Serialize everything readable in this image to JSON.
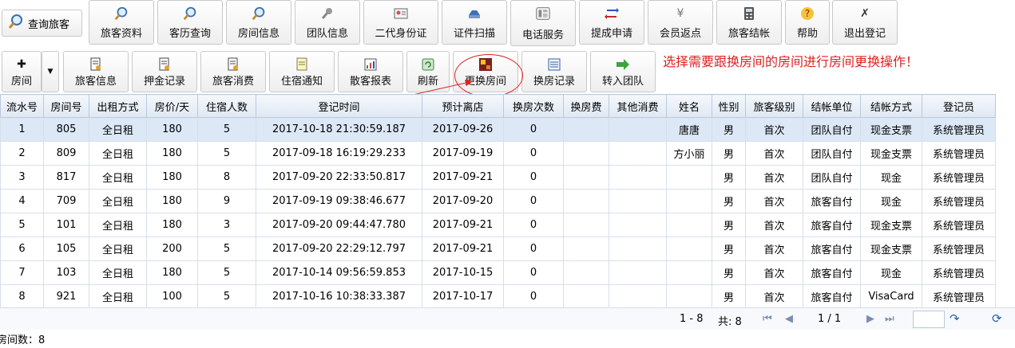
{
  "toolbar1": {
    "search_label": "查询旅客",
    "buttons": [
      {
        "label": "旅客资料",
        "icon": "magnifier-icon"
      },
      {
        "label": "客历查询",
        "icon": "magnifier-icon"
      },
      {
        "label": "房间信息",
        "icon": "magnifier-icon"
      },
      {
        "label": "团队信息",
        "icon": "wrench-icon"
      },
      {
        "label": "二代身份证",
        "icon": "id-card-icon"
      },
      {
        "label": "证件扫描",
        "icon": "scanner-icon"
      },
      {
        "label": "电话服务",
        "icon": "telephone-icon"
      },
      {
        "label": "提成申请",
        "icon": "arrows-icon"
      },
      {
        "label": "会员返点",
        "icon": "yen-icon"
      },
      {
        "label": "旅客结帐",
        "icon": "calculator-icon"
      },
      {
        "label": "帮助",
        "icon": "help-icon"
      },
      {
        "label": "退出登记",
        "icon": "close-icon"
      }
    ]
  },
  "toolbar2": {
    "room_label": "房间",
    "buttons": [
      {
        "label": "旅客信息",
        "icon": "document-icon"
      },
      {
        "label": "押金记录",
        "icon": "document-icon"
      },
      {
        "label": "旅客消费",
        "icon": "document-icon"
      },
      {
        "label": "住宿通知",
        "icon": "note-icon"
      },
      {
        "label": "散客报表",
        "icon": "report-icon"
      },
      {
        "label": "刷新",
        "icon": "refresh-icon"
      },
      {
        "label": "更换房间",
        "icon": "swap-room-icon"
      },
      {
        "label": "换房记录",
        "icon": "list-icon"
      },
      {
        "label": "转入团队",
        "icon": "green-arrow-icon"
      }
    ]
  },
  "annotation": "选择需要跟换房间的房间进行房间更换操作！",
  "table": {
    "headers": [
      "流水号",
      "房间号",
      "出租方式",
      "房价/天",
      "住宿人数",
      "登记时间",
      "预计离店",
      "换房次数",
      "换房费",
      "其他消费",
      "姓名",
      "性别",
      "旅客级别",
      "结帐单位",
      "结帐方式",
      "登记员"
    ],
    "rows": [
      [
        "1",
        "805",
        "全日租",
        "180",
        "5",
        "2017-10-18 21:30:59.187",
        "2017-09-26",
        "0",
        "",
        "",
        "唐唐",
        "男",
        "首次",
        "团队自付",
        "现金支票",
        "系统管理员"
      ],
      [
        "2",
        "809",
        "全日租",
        "180",
        "5",
        "2017-09-18 16:19:29.233",
        "2017-09-19",
        "0",
        "",
        "",
        "方小丽",
        "男",
        "首次",
        "团队自付",
        "现金支票",
        "系统管理员"
      ],
      [
        "3",
        "817",
        "全日租",
        "180",
        "8",
        "2017-09-20 22:33:50.817",
        "2017-09-21",
        "0",
        "",
        "",
        "",
        "男",
        "首次",
        "团队自付",
        "现金",
        "系统管理员"
      ],
      [
        "4",
        "709",
        "全日租",
        "180",
        "9",
        "2017-09-19 09:38:46.677",
        "2017-09-20",
        "0",
        "",
        "",
        "",
        "男",
        "首次",
        "旅客自付",
        "现金",
        "系统管理员"
      ],
      [
        "5",
        "101",
        "全日租",
        "180",
        "3",
        "2017-09-20 09:44:47.780",
        "2017-09-21",
        "0",
        "",
        "",
        "",
        "男",
        "首次",
        "旅客自付",
        "现金支票",
        "系统管理员"
      ],
      [
        "6",
        "105",
        "全日租",
        "200",
        "5",
        "2017-09-20 22:29:12.797",
        "2017-09-21",
        "0",
        "",
        "",
        "",
        "男",
        "首次",
        "旅客自付",
        "现金支票",
        "系统管理员"
      ],
      [
        "7",
        "103",
        "全日租",
        "180",
        "5",
        "2017-10-14 09:56:59.853",
        "2017-10-15",
        "0",
        "",
        "",
        "",
        "男",
        "首次",
        "旅客自付",
        "现金",
        "系统管理员"
      ],
      [
        "8",
        "921",
        "全日租",
        "100",
        "5",
        "2017-10-16 10:38:33.387",
        "2017-10-17",
        "0",
        "",
        "",
        "",
        "男",
        "首次",
        "旅客自付",
        "VisaCard",
        "系统管理员"
      ]
    ]
  },
  "pager": {
    "range": "1 - 8",
    "total": "共: 8",
    "page": "1 / 1"
  },
  "footer": "房间数：8"
}
